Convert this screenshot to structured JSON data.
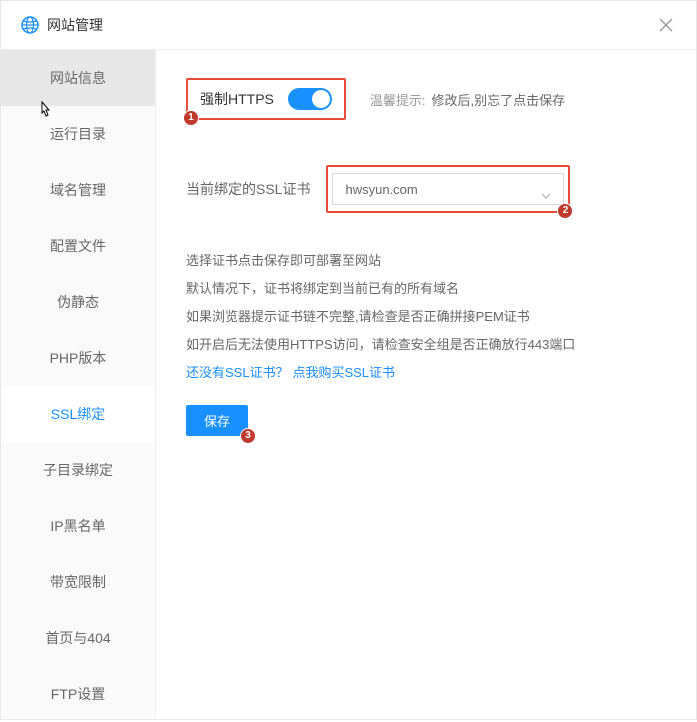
{
  "header": {
    "title": "网站管理"
  },
  "sidebar": {
    "items": [
      {
        "label": "网站信息"
      },
      {
        "label": "运行目录"
      },
      {
        "label": "域名管理"
      },
      {
        "label": "配置文件"
      },
      {
        "label": "伪静态"
      },
      {
        "label": "PHP版本"
      },
      {
        "label": "SSL绑定"
      },
      {
        "label": "子目录绑定"
      },
      {
        "label": "IP黑名单"
      },
      {
        "label": "带宽限制"
      },
      {
        "label": "首页与404"
      },
      {
        "label": "FTP设置"
      }
    ]
  },
  "content": {
    "force_https_label": "强制HTTPS",
    "hint_label": "温馨提示:",
    "hint_text": "修改后,别忘了点击保存",
    "ssl_bind_label": "当前绑定的SSL证书",
    "ssl_selected": "hwsyun.com",
    "info1": "选择证书点击保存即可部署至网站",
    "info2": "默认情况下，证书将绑定到当前已有的所有域名",
    "info3": "如果浏览器提示证书链不完整,请检查是否正确拼接PEM证书",
    "info4": "如开启后无法使用HTTPS访问，请检查安全组是否正确放行443端口",
    "link1": "还没有SSL证书？",
    "link2": "点我购买SSL证书",
    "save_label": "保存"
  },
  "badges": {
    "b1": "1",
    "b2": "2",
    "b3": "3"
  }
}
